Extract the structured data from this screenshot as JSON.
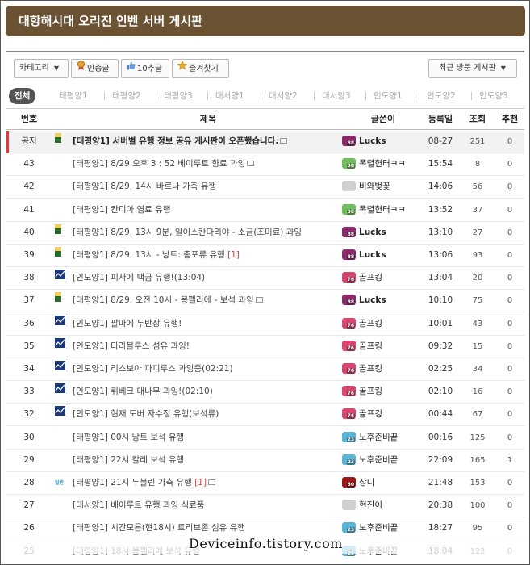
{
  "header": {
    "title": "대항해시대 오리진 인벤 서버 게시판"
  },
  "toolbar": {
    "category_label": "카테고리",
    "certified_label": "인증글",
    "recommend_label": "10추글",
    "favorite_label": "즐겨찾기",
    "sort_label": "최근 방문 게시판",
    "icons": {
      "certified": "medal-icon",
      "recommend": "thumbs-up-icon",
      "favorite": "star-icon",
      "dropdown": "chevron-down-icon"
    }
  },
  "tabs": [
    "전체",
    "태평양1",
    "태평양2",
    "태평양3",
    "대서양1",
    "대서양2",
    "대서양3",
    "인도양1",
    "인도양2",
    "인도양3"
  ],
  "columns": {
    "num": "번호",
    "title": "제목",
    "author": "글쓴이",
    "date": "등록일",
    "views": "조회",
    "rec": "추천"
  },
  "rows": [
    {
      "num": "공지",
      "cat": "flag",
      "title": "[태평양1] 서버별 유행 정보 공유 게시판이 오픈했습니다.",
      "img": true,
      "comments": "",
      "author": "Lucks",
      "lvl": "88",
      "lvlColor": "#8a2a6a",
      "date": "08-27",
      "views": "251",
      "rec": "0",
      "notice": true
    },
    {
      "num": "43",
      "cat": "",
      "title": "[태평양1] 8/29 오후 3 : 52 베이루트 향료 과잉",
      "img": true,
      "comments": "",
      "author": "폭렬헌터ㅋㅋ",
      "lvl": "38",
      "lvlColor": "#6fbf5a",
      "date": "15:54",
      "views": "8",
      "rec": "0"
    },
    {
      "num": "42",
      "cat": "",
      "title": "[태평양1] 8/29, 14시 바르나 가축 유행",
      "img": false,
      "comments": "",
      "author": "비와벚꽃",
      "lvl": "",
      "lvlColor": "#cfcfcf",
      "date": "14:06",
      "views": "56",
      "rec": "0"
    },
    {
      "num": "41",
      "cat": "",
      "title": "[태평양1] 칸디아 염료 유행",
      "img": false,
      "comments": "",
      "author": "폭렬헌터ㅋㅋ",
      "lvl": "38",
      "lvlColor": "#6fbf5a",
      "date": "13:52",
      "views": "37",
      "rec": "0"
    },
    {
      "num": "40",
      "cat": "flag",
      "title": "[태평양1] 8/29, 13시 9분, 알이스칸다리야 - 소금(조미료) 과잉",
      "img": false,
      "comments": "",
      "author": "Lucks",
      "lvl": "88",
      "lvlColor": "#8a2a6a",
      "date": "13:10",
      "views": "27",
      "rec": "0"
    },
    {
      "num": "39",
      "cat": "flag",
      "title": "[태평양1] 8/29, 13시 - 낭트: 총포류 유행",
      "img": false,
      "comments": "[1]",
      "author": "Lucks",
      "lvl": "88",
      "lvlColor": "#8a2a6a",
      "date": "13:06",
      "views": "93",
      "rec": "0"
    },
    {
      "num": "38",
      "cat": "chart",
      "title": "[인도양1] 피사에 백금 유행!(13:04)",
      "img": false,
      "comments": "",
      "author": "골프킹",
      "lvl": "76",
      "lvlColor": "#d8456e",
      "date": "13:04",
      "views": "20",
      "rec": "0"
    },
    {
      "num": "37",
      "cat": "flag",
      "title": "[태평양1] 8/29, 오전 10시 - 몽펠리에 - 보석 과잉",
      "img": true,
      "comments": "",
      "author": "Lucks",
      "lvl": "88",
      "lvlColor": "#8a2a6a",
      "date": "10:10",
      "views": "75",
      "rec": "0"
    },
    {
      "num": "36",
      "cat": "chart",
      "title": "[인도양1] 팔마에 두반장 유행!",
      "img": false,
      "comments": "",
      "author": "골프킹",
      "lvl": "76",
      "lvlColor": "#d8456e",
      "date": "10:01",
      "views": "43",
      "rec": "0"
    },
    {
      "num": "35",
      "cat": "chart",
      "title": "[인도양1] 타라블루스 섬유 과잉!",
      "img": false,
      "comments": "",
      "author": "골프킹",
      "lvl": "76",
      "lvlColor": "#d8456e",
      "date": "09:32",
      "views": "15",
      "rec": "0"
    },
    {
      "num": "34",
      "cat": "chart",
      "title": "[인도양1] 리스보아 파피루스 과잉중(02:21)",
      "img": false,
      "comments": "",
      "author": "골프킹",
      "lvl": "76",
      "lvlColor": "#d8456e",
      "date": "02:25",
      "views": "34",
      "rec": "0"
    },
    {
      "num": "33",
      "cat": "chart",
      "title": "[인도양1] 뤼베크 대나무 과잉!(02:10)",
      "img": false,
      "comments": "",
      "author": "골프킹",
      "lvl": "76",
      "lvlColor": "#d8456e",
      "date": "02:10",
      "views": "16",
      "rec": "0"
    },
    {
      "num": "32",
      "cat": "chart",
      "title": "[인도양1] 현재 도버 자수정 유행(보석류)",
      "img": false,
      "comments": "",
      "author": "골프킹",
      "lvl": "76",
      "lvlColor": "#d8456e",
      "date": "00:44",
      "views": "67",
      "rec": "0"
    },
    {
      "num": "30",
      "cat": "",
      "title": "[태평양1] 00시 낭트 보석 유행",
      "img": false,
      "comments": "",
      "author": "노후준비끝",
      "lvl": "23",
      "lvlColor": "#5ab4d6",
      "date": "00:16",
      "views": "125",
      "rec": "0"
    },
    {
      "num": "29",
      "cat": "",
      "title": "[태평양1] 22시 칼레 보석 유행",
      "img": false,
      "comments": "",
      "author": "노후준비끝",
      "lvl": "23",
      "lvlColor": "#5ab4d6",
      "date": "22:09",
      "views": "165",
      "rec": "1"
    },
    {
      "num": "28",
      "cat": "text",
      "catText": "일반",
      "title": "[태평양1] 21시 두블린 가축 유행",
      "img": true,
      "comments": "[1]",
      "author": "상디",
      "lvl": "80",
      "lvlColor": "#9a1a1a",
      "date": "21:48",
      "views": "153",
      "rec": "0"
    },
    {
      "num": "27",
      "cat": "",
      "title": "[대서양1] 베이루트 유행 과잉 식료품",
      "img": false,
      "comments": "",
      "author": "현진이",
      "lvl": "",
      "lvlColor": "#cfcfcf",
      "date": "20:38",
      "views": "100",
      "rec": "0"
    },
    {
      "num": "26",
      "cat": "",
      "title": "[태평양1] 시간모름(현18시) 트리브존 섬유 유행",
      "img": false,
      "comments": "",
      "author": "노후준비끝",
      "lvl": "23",
      "lvlColor": "#5ab4d6",
      "date": "18:27",
      "views": "95",
      "rec": "0"
    },
    {
      "num": "25",
      "cat": "",
      "title": "[태평양1] 18시 몽펠리에 보석 유행",
      "img": false,
      "comments": "",
      "author": "노후준비끝",
      "lvl": "23",
      "lvlColor": "#5ab4d6",
      "date": "18:04",
      "views": "122",
      "rec": "0"
    }
  ],
  "watermark": "Deviceinfo.tistory.com",
  "colors": {
    "header_bg": "#6b5232",
    "notice_bar": "#e23a3a",
    "comment": "#e23a3a"
  }
}
